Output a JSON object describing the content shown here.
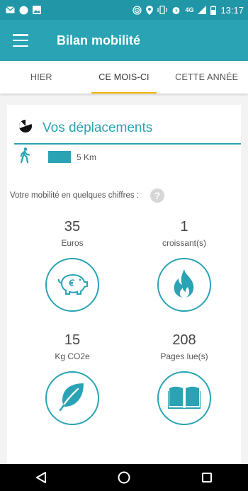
{
  "status_bar": {
    "network": "4G",
    "time": "13:17"
  },
  "app_bar": {
    "title": "Bilan mobilité",
    "menu_icon": "hamburger-menu-icon"
  },
  "tabs": [
    {
      "label": "HIER",
      "active": false
    },
    {
      "label": "CE MOIS-CI",
      "active": true
    },
    {
      "label": "CETTE ANNÉE",
      "active": false
    }
  ],
  "travel": {
    "title": "Vos déplacements",
    "mode_icon": "walking-person-icon",
    "distance": "5 Km"
  },
  "stats": {
    "intro": "Votre mobilité en quelques chiffres :",
    "help_icon": "help-icon",
    "items": [
      {
        "value": "35",
        "label": "Euros",
        "icon": "piggy-bank-euro-icon"
      },
      {
        "value": "1",
        "label": "croissant(s)",
        "icon": "flame-icon"
      },
      {
        "value": "15",
        "label": "Kg CO2e",
        "icon": "leaf-icon"
      },
      {
        "value": "208",
        "label": "Pages lue(s)",
        "icon": "open-book-icon"
      }
    ]
  },
  "colors": {
    "status_bar": "#2196a7",
    "primary": "#2aa3b4",
    "tab_indicator": "#f0b400"
  }
}
